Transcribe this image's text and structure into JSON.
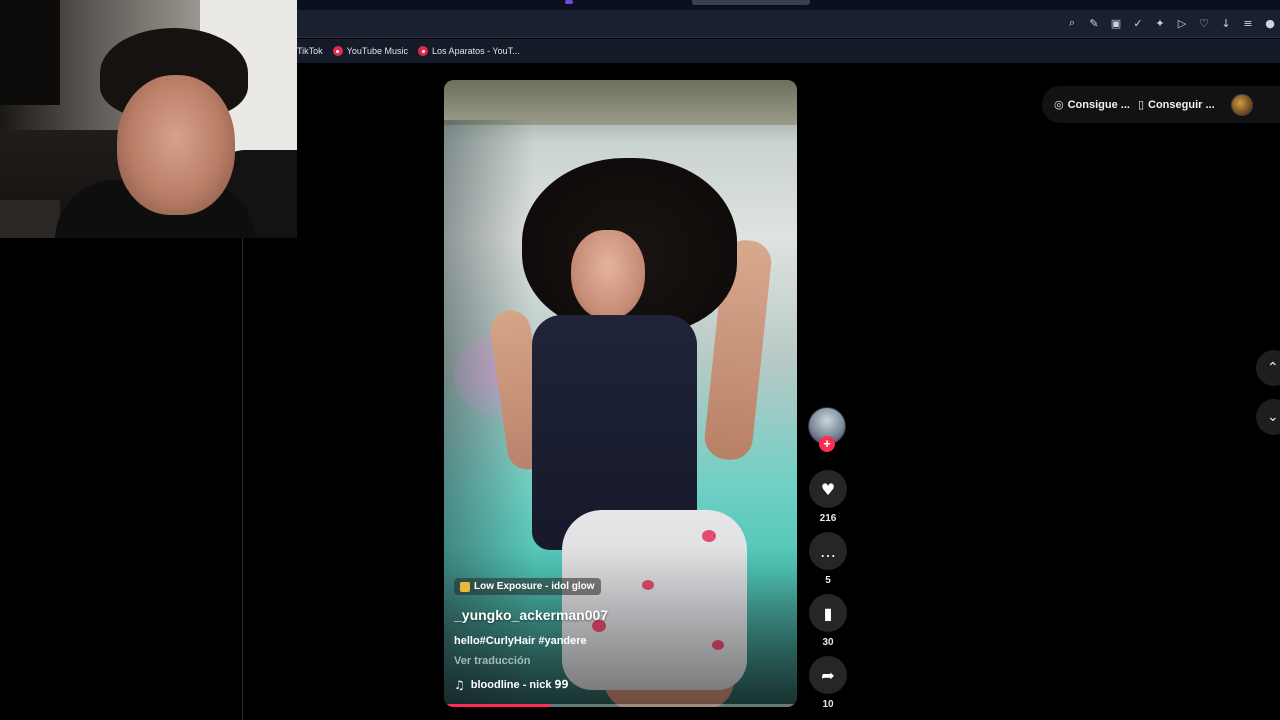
{
  "browser": {
    "toolbar_icons": [
      "zoom-icon",
      "edit-icon",
      "camera-icon",
      "shield-check-icon",
      "extension-icon",
      "play-icon",
      "heart-icon",
      "download-icon",
      "menu-icon",
      "profile-icon"
    ],
    "bookmarks": [
      {
        "label": "TikTok",
        "icon": "none"
      },
      {
        "label": "YouTube Music",
        "icon": "youtube-music-icon"
      },
      {
        "label": "Los Aparatos - YouT...",
        "icon": "youtube-music-icon"
      }
    ]
  },
  "header_actions": {
    "get_coins_label": "Consigue ...",
    "get_app_label": "Conseguir ..."
  },
  "video": {
    "effect_label": "Low Exposure - idol glow",
    "username": "_yungko_ackerman007",
    "caption": "hello#CurlyHair #yandere",
    "translate_label": "Ver traducción",
    "sound": "bloodline - nick 𝟫𝟫",
    "progress": 0.3
  },
  "actions": {
    "follow_symbol": "+",
    "likes": "216",
    "comments": "5",
    "saves": "30",
    "shares": "10"
  },
  "colors": {
    "accent": "#fe2c55",
    "background": "#000000"
  }
}
